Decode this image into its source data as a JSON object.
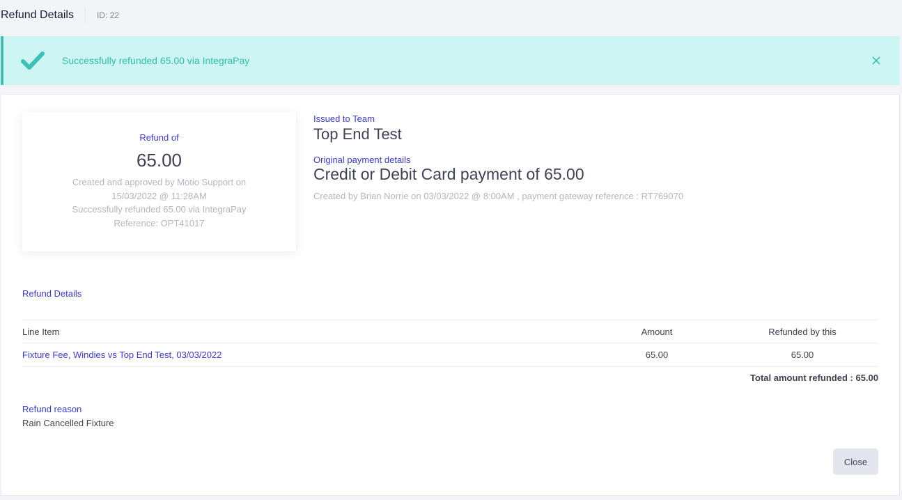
{
  "header": {
    "title": "Refund Details",
    "id_label": "ID: 22"
  },
  "alert": {
    "message": "Successfully refunded 65.00 via IntegraPay",
    "icon": "check-icon",
    "close_icon": "close-icon",
    "accent": "#3cc1b4"
  },
  "refund_summary": {
    "label": "Refund of",
    "amount": "65.00",
    "line1": "Created and approved by Motio Support on 15/03/2022 @ 11:28AM",
    "line2": "Successfully refunded 65.00 via IntegraPay",
    "line3": "Reference: OPT41017"
  },
  "issued": {
    "label": "Issued to Team",
    "team": "Top End Test"
  },
  "original_payment": {
    "label": "Original payment details",
    "title": "Credit or Debit Card payment of 65.00",
    "meta": "Created by Brian Norrie on 03/03/2022 @ 8:00AM , payment gateway reference : RT769070"
  },
  "details": {
    "label": "Refund Details",
    "columns": [
      "Line Item",
      "Amount",
      "Refunded by this"
    ],
    "rows": [
      {
        "item": "Fixture Fee, Windies vs Top End Test, 03/03/2022",
        "amount": "65.00",
        "refunded": "65.00"
      }
    ],
    "total": "Total amount refunded : 65.00"
  },
  "reason": {
    "label": "Refund reason",
    "text": "Rain Cancelled Fixture"
  },
  "actions": {
    "close_label": "Close"
  },
  "colors": {
    "link_blue": "#3b3bd6",
    "alert_bg": "#cdf5f3",
    "muted": "#b5b5c3"
  }
}
